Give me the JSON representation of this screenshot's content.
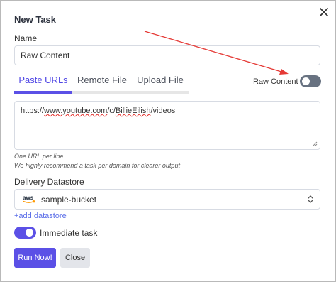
{
  "dialog": {
    "title": "New Task",
    "close_icon": "close-icon"
  },
  "name_field": {
    "label": "Name",
    "value": "Raw Content"
  },
  "tabs": [
    {
      "label": "Paste URLs",
      "active": true
    },
    {
      "label": "Remote File",
      "active": false
    },
    {
      "label": "Upload File",
      "active": false
    }
  ],
  "raw_content": {
    "label": "Raw Content",
    "enabled": false
  },
  "urls": {
    "prefix": "https://",
    "link1": "www.youtube.com",
    "middle": "/c/",
    "link2": "BillieEilish",
    "suffix": "/videos"
  },
  "hints": {
    "line1": "One URL per line",
    "line2": "We highly recommend a task per domain for clearer output"
  },
  "datastore": {
    "label": "Delivery Datastore",
    "provider_icon": "aws-logo",
    "value": "sample-bucket",
    "add_link": "+add datastore"
  },
  "immediate": {
    "label": "Immediate task",
    "enabled": true
  },
  "buttons": {
    "run": "Run Now!",
    "close": "Close"
  },
  "colors": {
    "accent": "#5b50e6",
    "annotation_arrow": "#e53935"
  }
}
